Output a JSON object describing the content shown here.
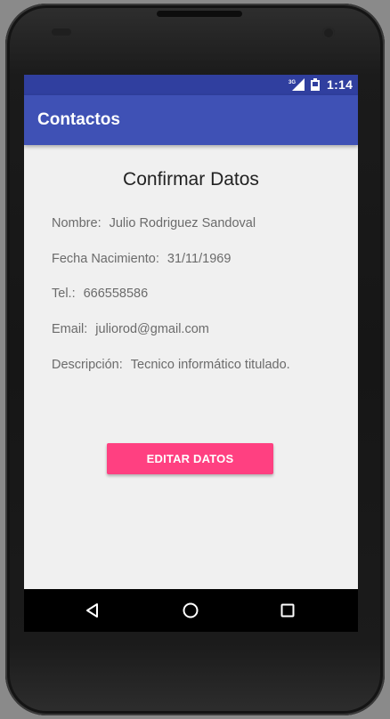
{
  "status_bar": {
    "network_label": "3G",
    "network_icon": "signal-icon",
    "battery_icon": "battery-icon",
    "time": "1:14"
  },
  "app_bar": {
    "title": "Contactos"
  },
  "content": {
    "heading": "Confirmar Datos",
    "fields": [
      {
        "label": "Nombre:",
        "value": "Julio Rodriguez Sandoval"
      },
      {
        "label": "Fecha Nacimiento:",
        "value": "31/11/1969"
      },
      {
        "label": "Tel.:",
        "value": "666558586"
      },
      {
        "label": "Email:",
        "value": "juliorod@gmail.com"
      },
      {
        "label": "Descripción:",
        "value": "Tecnico informático titulado."
      }
    ],
    "edit_button_label": "EDITAR DATOS"
  },
  "nav_bar": {
    "back_icon": "back-triangle-icon",
    "home_icon": "home-circle-icon",
    "recents_icon": "recents-square-icon"
  },
  "colors": {
    "status_bar": "#303f9f",
    "app_bar": "#3f51b5",
    "accent": "#ff4081",
    "background": "#f0f0f0"
  }
}
